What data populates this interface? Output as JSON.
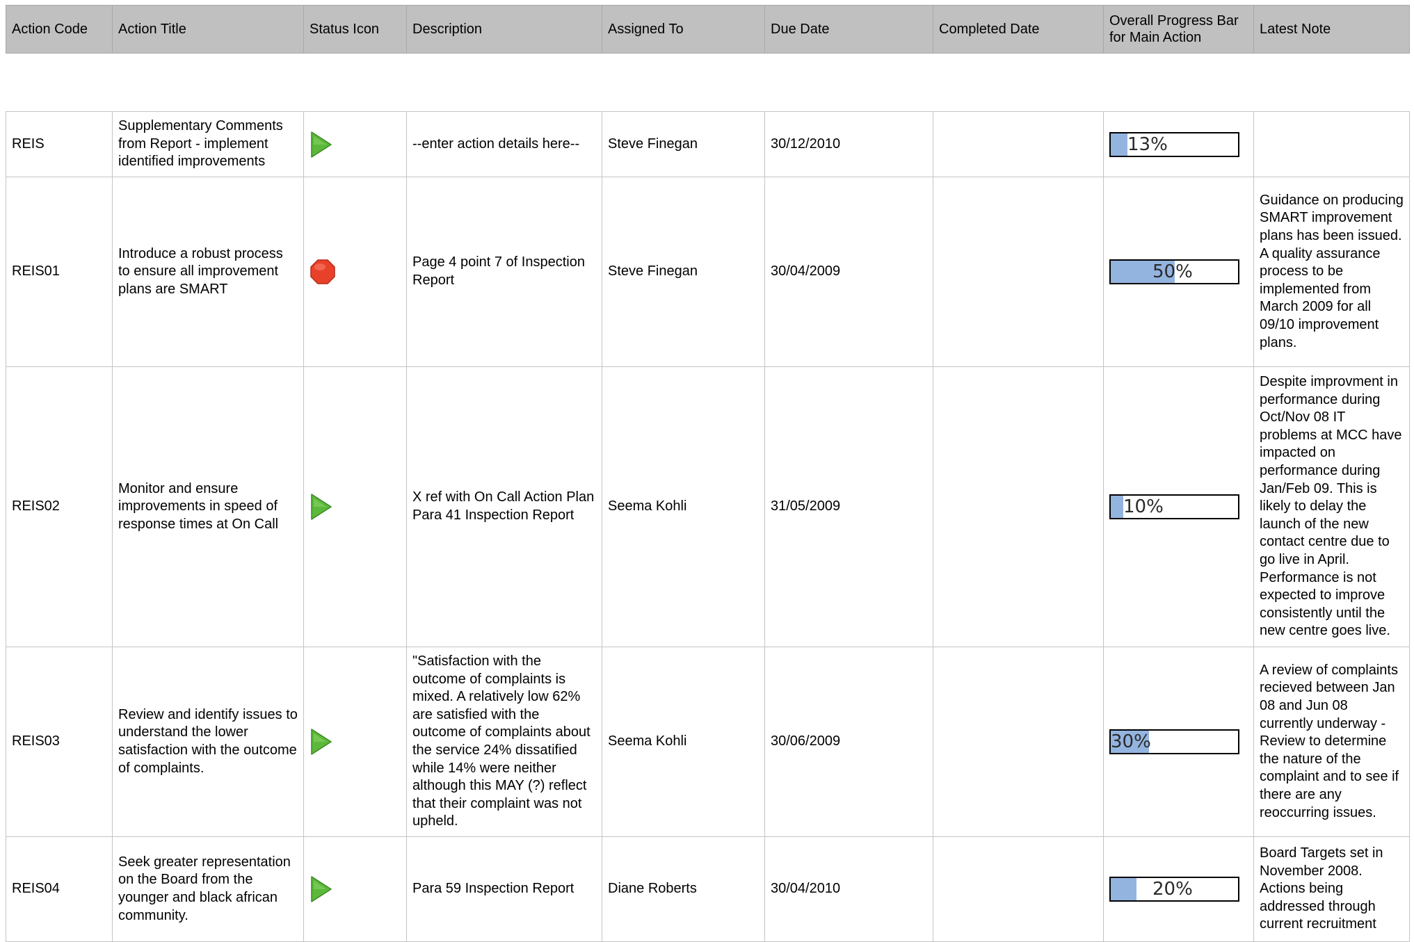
{
  "columns": [
    "Action Code",
    "Action Title",
    "Status Icon",
    "Description",
    "Assigned To",
    "Due Date",
    "Completed Date",
    "Overall Progress Bar for Main Action",
    "Latest Note"
  ],
  "colors": {
    "header_bg": "#c0c0c0",
    "progress_fill": "#94b4e0",
    "status_green": "#5cb83a",
    "status_red": "#e8412a"
  },
  "rows": [
    {
      "code": "REIS",
      "title": "Supplementary Comments from Report - implement identified improvements",
      "status_icon": "green-play-icon",
      "description": "--enter action details here--",
      "assigned_to": "Steve Finegan",
      "due_date": "30/12/2010",
      "completed_date": "",
      "progress": 13,
      "progress_label": "13%",
      "latest_note": ""
    },
    {
      "code": "REIS01",
      "title": "Introduce a robust process to ensure all improvement plans are SMART",
      "status_icon": "red-stop-icon",
      "description": "Page 4 point 7 of Inspection Report",
      "assigned_to": "Steve Finegan",
      "due_date": "30/04/2009",
      "completed_date": "",
      "progress": 50,
      "progress_label": "50%",
      "latest_note": "Guidance on producing SMART improvement plans has been issued. A quality assurance process to be implemented from March 2009 for all 09/10 improvement plans."
    },
    {
      "code": "REIS02",
      "title": "Monitor and ensure improvements in speed of response times at On Call",
      "status_icon": "green-play-icon",
      "description": "X ref with On Call Action Plan Para 41 Inspection Report",
      "assigned_to": "Seema Kohli",
      "due_date": "31/05/2009",
      "completed_date": "",
      "progress": 10,
      "progress_label": "10%",
      "latest_note": "Despite improvment in performance during Oct/Nov 08 IT problems at MCC have impacted on performance during Jan/Feb 09. This is likely to delay the launch of the new contact centre due to go live in April. Performance is not expected to improve consistently until the new centre goes live."
    },
    {
      "code": "REIS03",
      "title": "Review and identify issues to understand the lower satisfaction with the outcome of complaints.",
      "status_icon": "green-play-icon",
      "description": "\"Satisfaction with the outcome of complaints is mixed. A relatively low 62% are satisfied with the outcome of complaints about the service 24% dissatified while 14% were neither although this MAY (?) reflect that their complaint was not upheld.",
      "assigned_to": "Seema Kohli",
      "due_date": "30/06/2009",
      "completed_date": "",
      "progress": 30,
      "progress_label": "30%",
      "latest_note": "A review of complaints recieved between Jan 08 and Jun 08 currently underway - Review to determine the nature of the complaint and to see if there are any reoccurring issues."
    },
    {
      "code": "REIS04",
      "title": "Seek greater representation on the Board from the younger and black african community.",
      "status_icon": "green-play-icon",
      "description": "Para 59 Inspection Report",
      "assigned_to": "Diane Roberts",
      "due_date": "30/04/2010",
      "completed_date": "",
      "progress": 20,
      "progress_label": "20%",
      "latest_note": "Board Targets set in November 2008. Actions being addressed through current recruitment"
    }
  ]
}
